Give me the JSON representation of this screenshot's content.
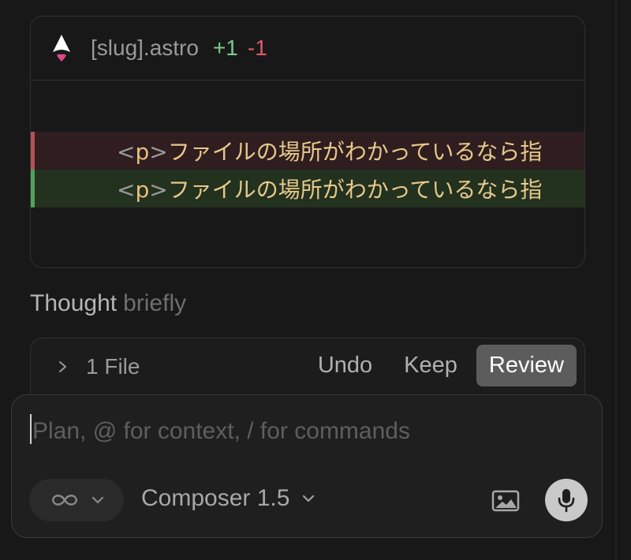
{
  "diff": {
    "filename": "[slug].astro",
    "additions": "+1",
    "deletions": "-1",
    "removed_line": {
      "tag_open": "<",
      "tag_name": "p",
      "tag_close": ">",
      "text": "ファイルの場所がわかっているなら指"
    },
    "added_line": {
      "tag_open": "<",
      "tag_name": "p",
      "tag_close": ">",
      "text": "ファイルの場所がわかっているなら指"
    }
  },
  "thought": {
    "label": "Thought",
    "duration": "briefly"
  },
  "files_bar": {
    "file_count_label": "1 File",
    "undo_label": "Undo",
    "keep_label": "Keep",
    "review_label": "Review"
  },
  "composer": {
    "placeholder": "Plan, @ for context, / for commands",
    "mode_icon": "infinity-icon",
    "model_label": "Composer 1.5"
  },
  "colors": {
    "background": "#181818",
    "added": "#7fc98b",
    "removed": "#e0596b",
    "review_button": "#5c5c5c"
  }
}
